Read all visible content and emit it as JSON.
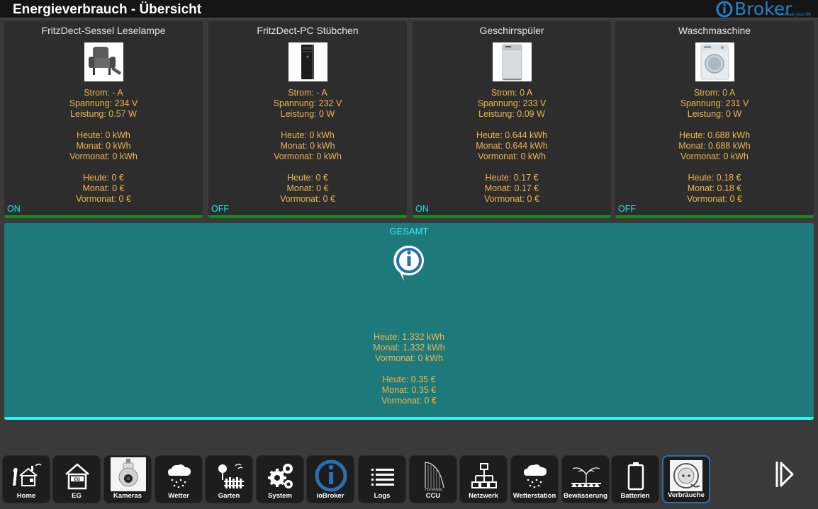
{
  "header": {
    "title": "Energieverbrauch - Übersicht",
    "logo_text": "Broker",
    "logo_tagline": "Automate your life"
  },
  "cards": [
    {
      "title": "FritzDect-Sessel Leselampe",
      "image": "armchair-image",
      "strom": "Strom: - A",
      "spannung": "Spannung: 234 V",
      "leistung": "Leistung: 0.57 W",
      "heute_kwh": "Heute: 0 kWh",
      "monat_kwh": "Monat: 0 kWh",
      "vormonat_kwh": "Vormonat: 0 kWh",
      "heute_eur": "Heute: 0 €",
      "monat_eur": "Monat: 0 €",
      "vormonat_eur": "Vormonat: 0 €",
      "state": "ON"
    },
    {
      "title": "FritzDect-PC Stübchen",
      "image": "pc-tower-image",
      "strom": "Strom: - A",
      "spannung": "Spannung: 232 V",
      "leistung": "Leistung: 0 W",
      "heute_kwh": "Heute: 0 kWh",
      "monat_kwh": "Monat: 0 kWh",
      "vormonat_kwh": "Vormonat: 0 kWh",
      "heute_eur": "Heute: 0 €",
      "monat_eur": "Monat: 0 €",
      "vormonat_eur": "Vormonat: 0 €",
      "state": "OFF"
    },
    {
      "title": "Geschirrspüler",
      "image": "dishwasher-image",
      "strom": "Strom: 0 A",
      "spannung": "Spannung: 233 V",
      "leistung": "Leistung: 0.09 W",
      "heute_kwh": "Heute: 0.644 kWh",
      "monat_kwh": "Monat: 0.644 kWh",
      "vormonat_kwh": "Vormonat: 0 kWh",
      "heute_eur": "Heute: 0.17 €",
      "monat_eur": "Monat: 0.17 €",
      "vormonat_eur": "Vormonat: 0 €",
      "state": "ON"
    },
    {
      "title": "Waschmaschine",
      "image": "washing-machine-image",
      "strom": "Strom: 0 A",
      "spannung": "Spannung: 231 V",
      "leistung": "Leistung: 0 W",
      "heute_kwh": "Heute: 0.688 kWh",
      "monat_kwh": "Monat: 0.688 kWh",
      "vormonat_kwh": "Vormonat: 0 kWh",
      "heute_eur": "Heute: 0.18 €",
      "monat_eur": "Monat: 0.18 €",
      "vormonat_eur": "Vormonat: 0 €",
      "state": "OFF"
    }
  ],
  "gesamt": {
    "title": "GESAMT",
    "heute_kwh": "Heute: 1.332 kWh",
    "monat_kwh": "Monat: 1.332 kWh",
    "vormonat_kwh": "Vormonat: 0 kWh",
    "heute_eur": "Heute: 0.35 €",
    "monat_eur": "Monat: 0.35 €",
    "vormonat_eur": "Vormonat: 0 €"
  },
  "nav": [
    {
      "label": "Home",
      "icon": "house-icon"
    },
    {
      "label": "EG",
      "icon": "floor-icon",
      "icon_text": "EG"
    },
    {
      "label": "Kameras",
      "icon": "camera-icon"
    },
    {
      "label": "Wetter",
      "icon": "weather-icon"
    },
    {
      "label": "Garten",
      "icon": "garden-icon"
    },
    {
      "label": "System",
      "icon": "gears-icon"
    },
    {
      "label": "ioBroker",
      "icon": "iobroker-icon"
    },
    {
      "label": "Logs",
      "icon": "logs-icon"
    },
    {
      "label": "CCU",
      "icon": "ccu-icon",
      "icon_text": "HomeMatic"
    },
    {
      "label": "Netzwerk",
      "icon": "network-icon"
    },
    {
      "label": "Wetterstation",
      "icon": "weather-station-icon"
    },
    {
      "label": "Bewässerung",
      "icon": "sprinkler-icon"
    },
    {
      "label": "Batterien",
      "icon": "battery-icon"
    },
    {
      "label": "Verbräuche",
      "icon": "plug-icon",
      "active": true
    }
  ],
  "colors": {
    "card_bg": "#2d2d2d",
    "value_text": "#f0b44c",
    "state_text": "#2de0e0",
    "gesamt_bg": "#1e7a7a",
    "gesamt_accent": "#35f0f0",
    "on_bar": "#1a8a1a"
  }
}
